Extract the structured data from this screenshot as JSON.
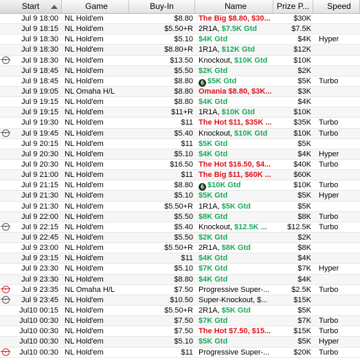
{
  "header": {
    "start": "Start",
    "game": "Game",
    "buyin": "Buy-In",
    "name": "Name",
    "prize": "Prize P...",
    "speed": "Speed"
  },
  "rows": [
    {
      "start": "Jul 9  18:00",
      "game": "NL Hold'em",
      "buyin": "$8.80",
      "name": "The Big $8.80, $30...",
      "style": "red",
      "prize": "$30K",
      "speed": "",
      "icon": ""
    },
    {
      "start": "Jul 9  18:15",
      "game": "NL Hold'em",
      "buyin": "$5.50+R",
      "name": "2R1A, $7.5K Gtd",
      "style": "mixed",
      "prize": "$7.5K",
      "speed": "",
      "icon": ""
    },
    {
      "start": "Jul 9  18:30",
      "game": "NL Hold'em",
      "buyin": "$5.10",
      "name": "$4K Gtd",
      "style": "green",
      "prize": "$4K",
      "speed": "Hyper",
      "icon": ""
    },
    {
      "start": "Jul 9  18:30",
      "game": "NL Hold'em",
      "buyin": "$8.80+R",
      "name": "1R1A, $12K Gtd",
      "style": "mixed",
      "prize": "$12K",
      "speed": "",
      "icon": ""
    },
    {
      "start": "Jul 9  18:30",
      "game": "NL Hold'em",
      "buyin": "$13.50",
      "name": "Knockout, $10K Gtd",
      "style": "mixed",
      "prize": "$10K",
      "speed": "",
      "icon": "target"
    },
    {
      "start": "Jul 9  18:45",
      "game": "NL Hold'em",
      "buyin": "$5.50",
      "name": "$2K Gtd",
      "style": "green",
      "prize": "$2K",
      "speed": "",
      "icon": ""
    },
    {
      "start": "Jul 9  18:45",
      "game": "NL Hold'em",
      "buyin": "$8.80",
      "name": "$5K Gtd",
      "style": "green",
      "prize": "$5K",
      "speed": "Turbo",
      "icon": "",
      "six": true
    },
    {
      "start": "Jul 9  19:05",
      "game": "NL Omaha H/L",
      "buyin": "$8.80",
      "name": "Omania $8.80, $3K...",
      "style": "red",
      "prize": "$3K",
      "speed": "",
      "icon": ""
    },
    {
      "start": "Jul 9  19:15",
      "game": "NL Hold'em",
      "buyin": "$8.80",
      "name": "$4K Gtd",
      "style": "green",
      "prize": "$4K",
      "speed": "",
      "icon": ""
    },
    {
      "start": "Jul 9  19:15",
      "game": "NL Hold'em",
      "buyin": "$11+R",
      "name": "1R1A, $10K Gtd",
      "style": "mixed",
      "prize": "$10K",
      "speed": "",
      "icon": ""
    },
    {
      "start": "Jul 9  19:30",
      "game": "NL Hold'em",
      "buyin": "$11",
      "name": "The Hot $11, $35K ...",
      "style": "red",
      "prize": "$35K",
      "speed": "Turbo",
      "icon": ""
    },
    {
      "start": "Jul 9  19:45",
      "game": "NL Hold'em",
      "buyin": "$5.40",
      "name": "Knockout, $10K Gtd",
      "style": "mixed",
      "prize": "$10K",
      "speed": "Turbo",
      "icon": "target"
    },
    {
      "start": "Jul 9  20:15",
      "game": "NL Hold'em",
      "buyin": "$11",
      "name": "$5K Gtd",
      "style": "green",
      "prize": "$5K",
      "speed": "",
      "icon": ""
    },
    {
      "start": "Jul 9  20:30",
      "game": "NL Hold'em",
      "buyin": "$5.10",
      "name": "$4K Gtd",
      "style": "green",
      "prize": "$4K",
      "speed": "Hyper",
      "icon": ""
    },
    {
      "start": "Jul 9  20:30",
      "game": "NL Hold'em",
      "buyin": "$16.50",
      "name": "The Hot $16.50, $4...",
      "style": "red",
      "prize": "$40K",
      "speed": "Turbo",
      "icon": ""
    },
    {
      "start": "Jul 9  21:00",
      "game": "NL Hold'em",
      "buyin": "$11",
      "name": "The Big $11, $60K ...",
      "style": "red",
      "prize": "$60K",
      "speed": "",
      "icon": ""
    },
    {
      "start": "Jul 9  21:15",
      "game": "NL Hold'em",
      "buyin": "$8.80",
      "name": "$10K Gtd",
      "style": "green",
      "prize": "$10K",
      "speed": "Turbo",
      "icon": "",
      "six": true
    },
    {
      "start": "Jul 9  21:30",
      "game": "NL Hold'em",
      "buyin": "$5.10",
      "name": "$5K Gtd",
      "style": "green",
      "prize": "$5K",
      "speed": "Hyper",
      "icon": ""
    },
    {
      "start": "Jul 9  21:30",
      "game": "NL Hold'em",
      "buyin": "$5.50+R",
      "name": "1R1A, $5K Gtd",
      "style": "mixed",
      "prize": "$5K",
      "speed": "",
      "icon": ""
    },
    {
      "start": "Jul 9  22:00",
      "game": "NL Hold'em",
      "buyin": "$5.50",
      "name": "$8K Gtd",
      "style": "green",
      "prize": "$8K",
      "speed": "Turbo",
      "icon": ""
    },
    {
      "start": "Jul 9  22:15",
      "game": "NL Hold'em",
      "buyin": "$5.40",
      "name": "Knockout, $12.5K ...",
      "style": "mixed",
      "prize": "$12.5K",
      "speed": "Turbo",
      "icon": "target"
    },
    {
      "start": "Jul 9  22:45",
      "game": "NL Hold'em",
      "buyin": "$5.50",
      "name": "$2K Gtd",
      "style": "green",
      "prize": "$2K",
      "speed": "",
      "icon": ""
    },
    {
      "start": "Jul 9  23:00",
      "game": "NL Hold'em",
      "buyin": "$5.50+R",
      "name": "2R1A, $8K Gtd",
      "style": "mixed",
      "prize": "$8K",
      "speed": "",
      "icon": ""
    },
    {
      "start": "Jul 9  23:15",
      "game": "NL Hold'em",
      "buyin": "$11",
      "name": "$4K Gtd",
      "style": "green",
      "prize": "$4K",
      "speed": "",
      "icon": ""
    },
    {
      "start": "Jul 9  23:30",
      "game": "NL Hold'em",
      "buyin": "$5.10",
      "name": "$7K Gtd",
      "style": "green",
      "prize": "$7K",
      "speed": "Hyper",
      "icon": ""
    },
    {
      "start": "Jul 9  23:30",
      "game": "NL Hold'em",
      "buyin": "$8.80",
      "name": "$4K Gtd",
      "style": "green",
      "prize": "$4K",
      "speed": "",
      "icon": ""
    },
    {
      "start": "Jul 9  23:35",
      "game": "NL Omaha H/L",
      "buyin": "$7.50",
      "name": "Progressive Super-...",
      "style": "plain",
      "prize": "$2.5K",
      "speed": "Turbo",
      "icon": "target-red"
    },
    {
      "start": "Jul 9  23:45",
      "game": "NL Hold'em",
      "buyin": "$10.50",
      "name": "Super-Knockout, $...",
      "style": "plain",
      "prize": "$15K",
      "speed": "",
      "icon": "target"
    },
    {
      "start": "Jul10  00:15",
      "game": "NL Hold'em",
      "buyin": "$5.50+R",
      "name": "2R1A, $5K Gtd",
      "style": "mixed",
      "prize": "$5K",
      "speed": "",
      "icon": ""
    },
    {
      "start": "Jul10  00:30",
      "game": "NL Hold'em",
      "buyin": "$7.50",
      "name": "$7K Gtd",
      "style": "green",
      "prize": "$7K",
      "speed": "Turbo",
      "icon": ""
    },
    {
      "start": "Jul10  00:30",
      "game": "NL Hold'em",
      "buyin": "$7.50",
      "name": "The Hot $7.50, $15...",
      "style": "red",
      "prize": "$15K",
      "speed": "Turbo",
      "icon": ""
    },
    {
      "start": "Jul10  00:30",
      "game": "NL Hold'em",
      "buyin": "$5.10",
      "name": "$5K Gtd",
      "style": "green",
      "prize": "$5K",
      "speed": "Hyper",
      "icon": ""
    },
    {
      "start": "Jul10  00:30",
      "game": "NL Hold'em",
      "buyin": "$11",
      "name": "Progressive Super-...",
      "style": "plain",
      "prize": "$20K",
      "speed": "Turbo",
      "icon": "target-red"
    }
  ],
  "colors": {
    "red": "#e0101a",
    "green": "#1aa85a"
  }
}
